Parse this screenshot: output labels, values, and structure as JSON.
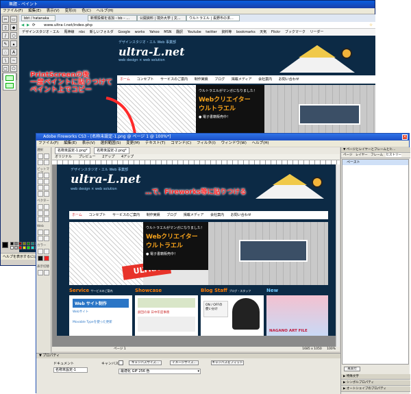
{
  "paint": {
    "title": "無題 - ペイント",
    "menu": [
      "ファイル(F)",
      "編集(E)",
      "表示(V)",
      "変形(I)",
      "色(C)",
      "ヘルプ(H)"
    ],
    "status": "ヘルプを表示するには、[ヘルプ] メニューの [トピックの検索] をクリックしてください。"
  },
  "browser": {
    "tabs": [
      "bbt / hatanaka",
      "新規投稿を追加 ‹ bb – …",
      "公開資料 | 境外大学 | 文…",
      "ウルトラエル | 長野市の求…"
    ],
    "address": "www.ultra-l.net/index.php",
    "bookmarks": [
      "デザインスタジオ・エル",
      "馬神線",
      "nbc",
      "新しいフォルダ",
      "Google",
      "works",
      "Yahoo",
      "MSN",
      "翻訳",
      "Youtube",
      "twitter",
      "資料等",
      "bookmarks",
      "天気",
      "Flickr",
      "ブックマーク",
      "リーダー"
    ]
  },
  "site": {
    "tagline": "デザインスタジオ・エル Web 事業部",
    "logo": "ultra-L.net",
    "sub_logo": "web design × web solution",
    "nav": [
      "ホーム",
      "コンセプト",
      "サービスのご案内",
      "制作実績",
      "ブログ",
      "掲載メディア",
      "会社案内",
      "お問い合わせ"
    ],
    "hero_intro": "ウルトラエルがマンガになりました！",
    "hero_title": "Webクリエイター",
    "hero_title2": "ウルトラエル",
    "hero_note": "● 電子書籍販売中！",
    "sections": [
      "Service",
      "Showcase",
      "Blog",
      "Staff",
      "New"
    ],
    "service_sub": "サービスのご案内",
    "staff_sub": "ブログ・スタッフ",
    "service_text": "Web サイト制作",
    "service_items": [
      "Webサイト",
      "Movable Typeを使った更新"
    ],
    "showcase_caption": "劇団の扉 日中年度事務",
    "blog_caption": "ON / OFFの 使い分け",
    "new_caption": "NAGANO ART FILE"
  },
  "annotations": {
    "step1_line1": "PrintScreenの後",
    "step1_line2": "一度ペイントに貼りつけて",
    "step1_line3": "ペイント上でコピー",
    "step2": "…で、Fireworks等に貼りつける"
  },
  "fireworks": {
    "title": "Adobe Fireworks CS3 - [名称未設定-1.png @ ページ 1 @ 100%*]",
    "menu": [
      "ファイル(F)",
      "編集(E)",
      "表示(V)",
      "選択範囲(S)",
      "変更(M)",
      "テキスト(T)",
      "コマンド(C)",
      "フィルタ(I)",
      "ウィンドウ(W)",
      "ヘルプ(H)"
    ],
    "doc_tabs": [
      "名称未設定-1.png*",
      "名称未設定-2.png*"
    ],
    "view_tabs": [
      "オリジナル",
      "プレビュー",
      "2アップ",
      "4アップ"
    ],
    "tool_sections": [
      "選択",
      "ビットマップ",
      "ベクター",
      "Web",
      "カラー",
      "表示切替"
    ],
    "status": "ページ 1",
    "size": "1685 x 1050",
    "zoom": "100%",
    "props_title": "▼ プロパティ",
    "doc_label": "ドキュメント",
    "doc_name": "名称未設定-1",
    "canvas_label": "キャンバス：",
    "btn_canvas_size": "キャンバスサイズ...",
    "btn_image_size": "イメージサイズ...",
    "btn_fit": "キャンバスをフィット",
    "palette": "最適化 GIF 256 色",
    "panel_tabs": "▼ ページとレイヤーとフレームとヒ…",
    "panel_sub": [
      "ページ",
      "レイヤー",
      "フレーム",
      "ヒストリー"
    ],
    "history_item": "ペースト",
    "replay": "再実行",
    "panel_footer": [
      "▶ 特殊文字",
      "▶ シンボルプロパティ",
      "▶ オートシェイプのプロパティ"
    ]
  },
  "colors": {
    "annotation": "#ff2a2a",
    "site_bg": "#0c2a45",
    "logo_white": "#ffffff",
    "logo_blue": "#6ec8ff"
  }
}
